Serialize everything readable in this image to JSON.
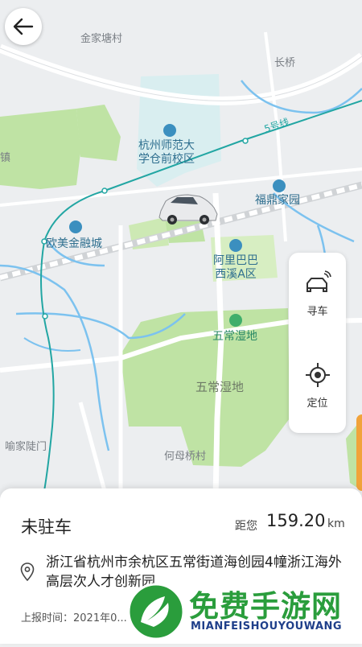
{
  "map": {
    "places": {
      "jinjiatang": "金家塘村",
      "changqiao": "长桥",
      "zhen": "镇",
      "hznu": [
        "杭州师范大",
        "学仓前校区"
      ],
      "fuding": "福鼎家园",
      "oumei": "欧美金融城",
      "alibaba": [
        "阿里巴巴",
        "西溪A区"
      ],
      "wuchang1": "五常湿地",
      "wuchang2": "五常湿地",
      "yujia": "喻家陡门",
      "hemu": "何母桥村",
      "metro_line": "5号线"
    }
  },
  "side_panel": {
    "find_car": {
      "label": "寻车",
      "icon": "car-signal-icon"
    },
    "locate": {
      "label": "定位",
      "icon": "locate-crosshair-icon"
    }
  },
  "sheet": {
    "status": "未驻车",
    "distance_label": "距您",
    "distance_value": "159.20",
    "distance_unit": "km",
    "address": "浙江省杭州市余杭区五常街道海创园4幢浙江海外高层次人才创新园",
    "report_time": "上报时间：2021年0... 17:"
  },
  "watermark": {
    "title": "免费手游网",
    "subtitle": "MIANFEISHOUYOUWANG"
  },
  "colors": {
    "metro": "#22a6a3",
    "park": "#bfe3a4",
    "river": "#7cc2ef",
    "watermark_green": "#2a9d3c"
  }
}
